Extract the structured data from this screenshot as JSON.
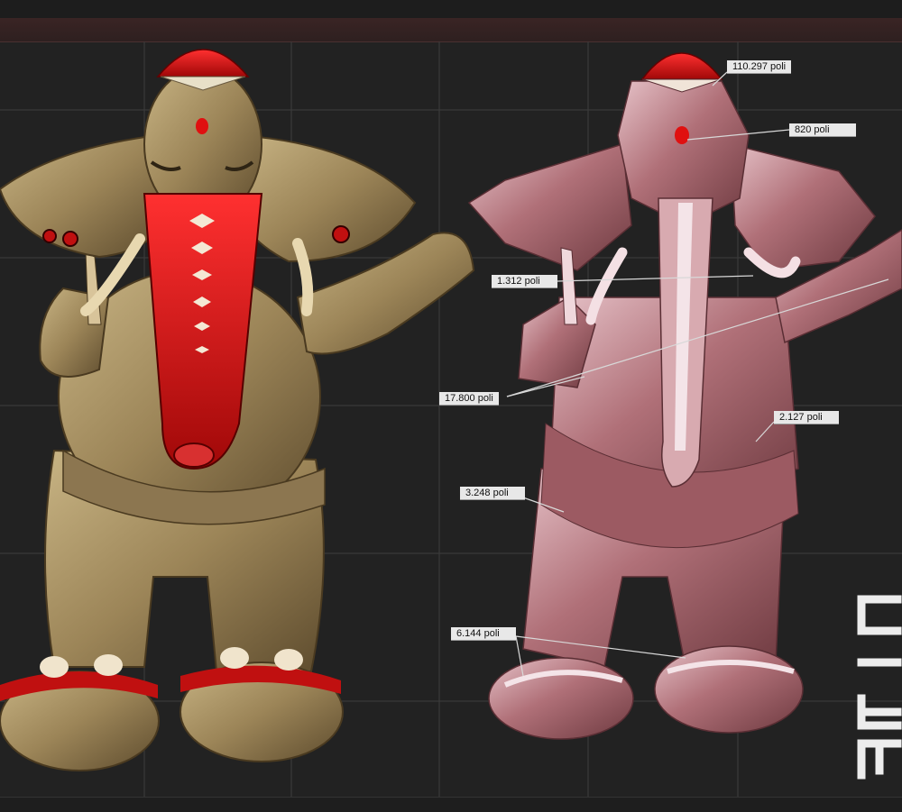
{
  "annotations": [
    {
      "id": "head",
      "label": "110.297 poli"
    },
    {
      "id": "bindi",
      "label": "820 poli"
    },
    {
      "id": "tusks",
      "label": "1.312 poli"
    },
    {
      "id": "hands",
      "label": "17.800 poli"
    },
    {
      "id": "belly",
      "label": "2.127 poli"
    },
    {
      "id": "cloth",
      "label": "3.248 poli"
    },
    {
      "id": "feet",
      "label": "6.144 poli"
    }
  ],
  "watermark": "CIEF",
  "colors": {
    "background": "#222222",
    "textured_model": "#a08a5c",
    "textured_red": "#d41414",
    "lowpoly_model": "#b8747a",
    "lowpoly_highlight": "#f0d8dc"
  }
}
